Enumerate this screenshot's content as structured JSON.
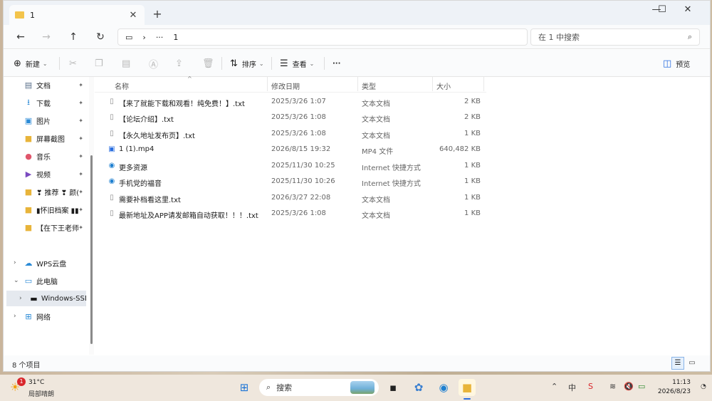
{
  "window": {
    "tab_title": "1",
    "tab_close": "✕",
    "new_tab": "+",
    "controls": {
      "minimize": "—",
      "maximize": "☐",
      "close": "✕"
    }
  },
  "address": {
    "back": "←",
    "forward": "→",
    "up": "↑",
    "refresh": "↻",
    "monitor_icon": "▭",
    "chevron": "›",
    "ellipsis": "···",
    "current": "1",
    "search_placeholder": "在 1 中搜索"
  },
  "commands": {
    "new_label": "新建",
    "sort_label": "排序",
    "view_label": "查看",
    "more": "···",
    "preview_label": "预览"
  },
  "sidebar": {
    "items": [
      {
        "label": "文档",
        "icon": "document-icon",
        "pinned": true
      },
      {
        "label": "下载",
        "icon": "download-icon",
        "pinned": true
      },
      {
        "label": "图片",
        "icon": "picture-icon",
        "pinned": true
      },
      {
        "label": "屏幕截图",
        "icon": "folder-icon",
        "pinned": true
      },
      {
        "label": "音乐",
        "icon": "music-icon",
        "pinned": true
      },
      {
        "label": "视频",
        "icon": "video-icon",
        "pinned": true
      },
      {
        "label": "❣ 推荐 ❣ 颜(",
        "icon": "folder-icon",
        "pinned": true
      },
      {
        "label": "▮怀旧档案 ▮▮",
        "icon": "folder-icon",
        "pinned": true
      },
      {
        "label": "【在下王老师",
        "icon": "folder-icon",
        "pinned": true
      }
    ],
    "tree": [
      {
        "label": "WPS云盘",
        "icon": "cloud-icon",
        "chevron": "›"
      },
      {
        "label": "此电脑",
        "icon": "pc-icon",
        "chevron": "⌄"
      },
      {
        "label": "Windows-SSD",
        "icon": "drive-icon",
        "chevron": "›",
        "selected": true
      },
      {
        "label": "网络",
        "icon": "network-icon",
        "chevron": "›"
      }
    ],
    "pin_glyph": "📌"
  },
  "columns": {
    "name": "名称",
    "modified": "修改日期",
    "type": "类型",
    "size": "大小"
  },
  "files": [
    {
      "name": "【来了就能下载和观看！纯免费！】.txt",
      "date": "2025/3/26 1:07",
      "type": "文本文档",
      "size": "2 KB",
      "icon": "txt"
    },
    {
      "name": "【论坛介绍】.txt",
      "date": "2025/3/26 1:08",
      "type": "文本文档",
      "size": "2 KB",
      "icon": "txt"
    },
    {
      "name": "【永久地址发布页】.txt",
      "date": "2025/3/26 1:08",
      "type": "文本文档",
      "size": "1 KB",
      "icon": "txt"
    },
    {
      "name": "1 (1).mp4",
      "date": "2026/8/15 19:32",
      "type": "MP4 文件",
      "size": "640,482 KB",
      "icon": "mp4"
    },
    {
      "name": "更多资源",
      "date": "2025/11/30 10:25",
      "type": "Internet 快捷方式",
      "size": "1 KB",
      "icon": "url"
    },
    {
      "name": "手机党的福音",
      "date": "2025/11/30 10:26",
      "type": "Internet 快捷方式",
      "size": "1 KB",
      "icon": "url"
    },
    {
      "name": "需要补档看这里.txt",
      "date": "2026/3/27 22:08",
      "type": "文本文档",
      "size": "1 KB",
      "icon": "txt"
    },
    {
      "name": "最新地址及APP请发邮箱自动获取！！！.txt",
      "date": "2025/3/26 1:08",
      "type": "文本文档",
      "size": "1 KB",
      "icon": "txt"
    }
  ],
  "status": {
    "count": "8 个项目"
  },
  "taskbar": {
    "weather_temp": "31°C",
    "weather_cond": "局部晴朗",
    "weather_badge": "1",
    "search_label": "搜索",
    "time": "11:13",
    "date": "2026/8/23",
    "ime": "中"
  }
}
